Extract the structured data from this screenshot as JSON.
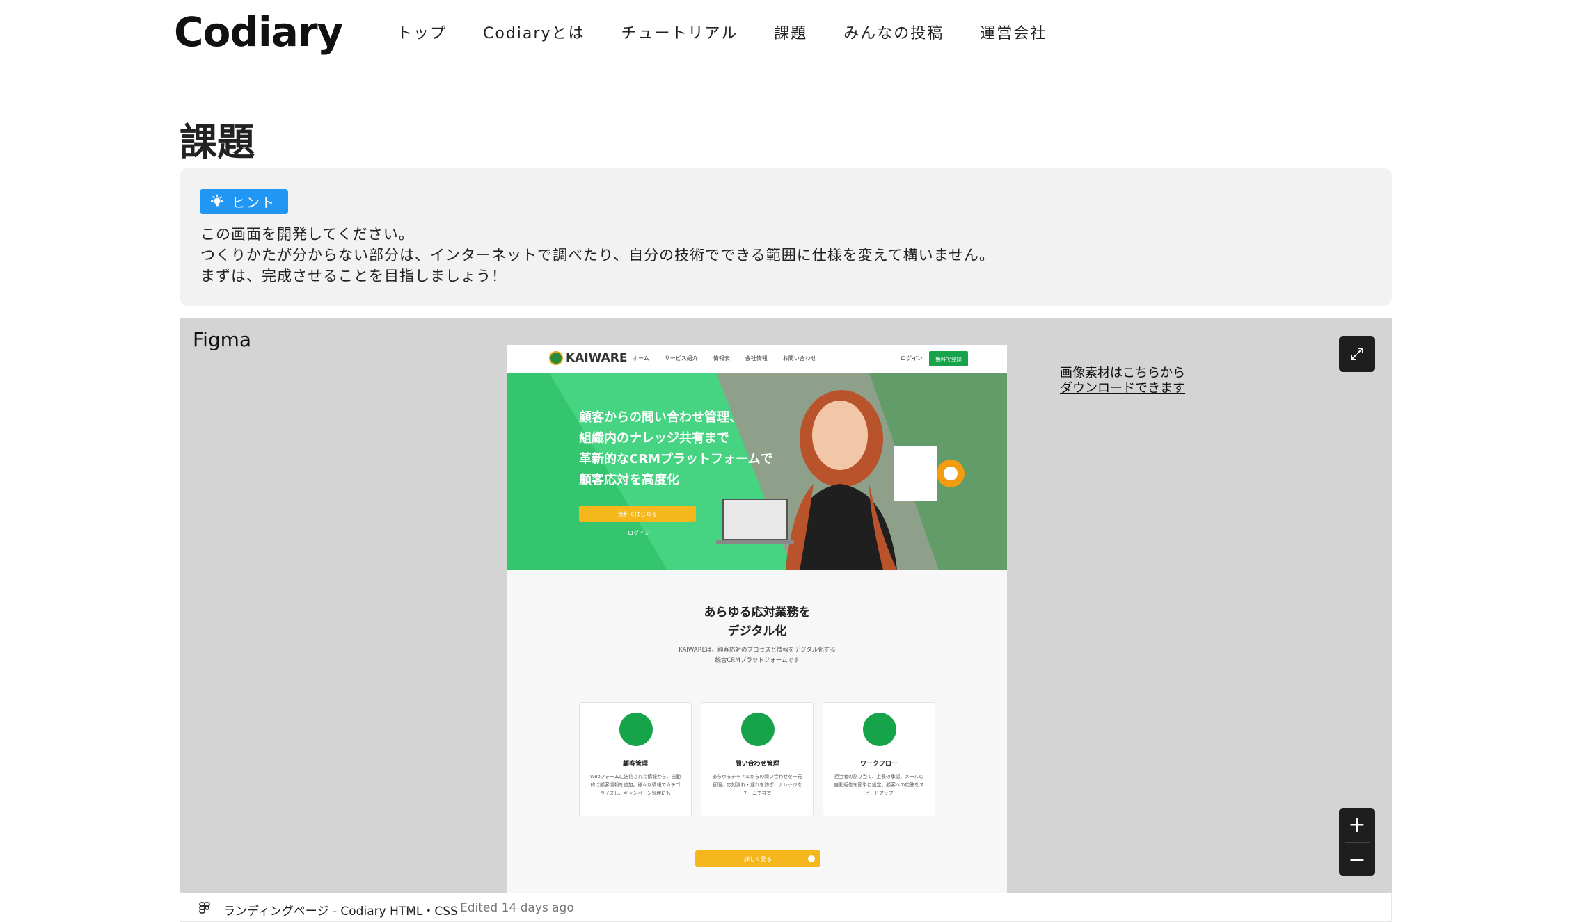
{
  "header": {
    "logo": "Codiary",
    "nav": [
      "トップ",
      "Codiaryとは",
      "チュートリアル",
      "課題",
      "みんなの投稿",
      "運営会社"
    ]
  },
  "page": {
    "title": "課題"
  },
  "hint": {
    "badge": "ヒント",
    "lines": [
      "この画面を開発してください。",
      "つくりかたが分からない部分は、インターネットで調べたり、自分の技術でできる範囲に仕様を変えて構いません。",
      "まずは、完成させることを目指しましょう！"
    ]
  },
  "figma": {
    "label": "Figma",
    "download_line1": "画像素材はこちらから",
    "download_line2": "ダウンロードできます",
    "zoom_in": "+",
    "zoom_out": "−",
    "file_title": "ランディングページ - Codiary HTML・CSS",
    "edited": "Edited 14 days ago"
  },
  "design": {
    "logo": "KAIWARE",
    "nav": [
      "ホーム",
      "サービス紹介",
      "情報表",
      "会社情報",
      "お問い合わせ"
    ],
    "login": "ログイン",
    "signup": "無料で登録",
    "hero_lines": [
      "顧客からの問い合わせ管理、",
      "組織内のナレッジ共有まで",
      "革新的なCRMプラットフォームで",
      "顧客応対を高度化"
    ],
    "hero_cta": "無料ではじめる",
    "hero_login": "ログイン",
    "section_title_1": "あらゆる応対業務を",
    "section_title_2": "デジタル化",
    "section_sub_1": "KAIWAREは、顧客応対のプロセスと情報をデジタル化する",
    "section_sub_2": "統合CRMプラットフォームです",
    "cards": [
      {
        "title": "顧客管理",
        "text": "Webフォームに送信された情報から、自動的に顧客情報を追加。様々な情報でカテゴライズし、キャンペーン管理にも"
      },
      {
        "title": "問い合わせ管理",
        "text": "あらゆるチャネルからの問い合わせを一元管理。応対漏れ・遅れを防ぎ、ナレッジをチームで共有"
      },
      {
        "title": "ワークフロー",
        "text": "担当者の割り当て、上長の承認、メールの自動返信を簡単に設定。顧客への応答をスピードアップ"
      }
    ],
    "more_btn": "詳しく見る"
  },
  "colors": {
    "accent_blue": "#2196f3",
    "brand_green": "#16a34a",
    "hero_green": "#3fcc78",
    "cta_yellow": "#f6b71c",
    "figma_bg": "#d4d4d4"
  }
}
